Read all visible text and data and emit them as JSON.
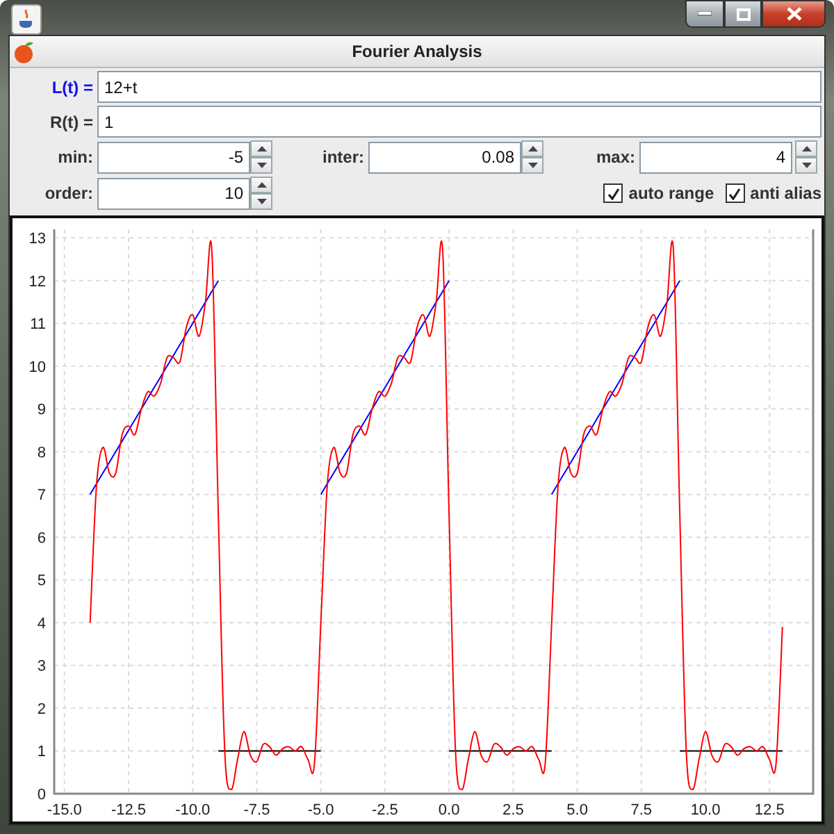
{
  "window": {
    "title": "Fourier Analysis"
  },
  "functions": [
    {
      "label": "L(t) =",
      "value": "12+t",
      "active": true
    },
    {
      "label": "R(t) =",
      "value": "1",
      "active": false
    }
  ],
  "spinners": [
    {
      "label": "min:",
      "value": "-5"
    },
    {
      "label": "inter:",
      "value": "0.08"
    },
    {
      "label": "max:",
      "value": "4"
    },
    {
      "label": "order:",
      "value": "10"
    }
  ],
  "checkboxes": [
    {
      "label": "auto range",
      "checked": true
    },
    {
      "label": "anti alias",
      "checked": true
    }
  ],
  "plot": {
    "chart_data": {
      "type": "line",
      "grid": true,
      "xlim": [
        -15.4,
        14.2
      ],
      "ylim": [
        0,
        13.2
      ],
      "xticks": [
        {
          "value": -15,
          "label": "-15.0"
        },
        {
          "value": -12.5,
          "label": "-12.5"
        },
        {
          "value": -10,
          "label": "-10.0"
        },
        {
          "value": -7.5,
          "label": "-7.5"
        },
        {
          "value": -5,
          "label": "-5.0"
        },
        {
          "value": -2.5,
          "label": "-2.5"
        },
        {
          "value": 0,
          "label": "0.0"
        },
        {
          "value": 2.5,
          "label": "2.5"
        },
        {
          "value": 5,
          "label": "5.0"
        },
        {
          "value": 7.5,
          "label": "7.5"
        },
        {
          "value": 10,
          "label": "10.0"
        },
        {
          "value": 12.5,
          "label": "12.5"
        }
      ],
      "yticks": [
        0,
        1,
        2,
        3,
        4,
        5,
        6,
        7,
        8,
        9,
        10,
        11,
        12,
        13
      ],
      "x": [
        -14,
        -13.75,
        -13.5,
        -13.25,
        -13,
        -12.75,
        -12.5,
        -12.25,
        -12,
        -11.75,
        -11.5,
        -11.25,
        -11,
        -10.75,
        -10.5,
        -10.25,
        -10,
        -9.75,
        -9.5,
        -9.25,
        -9,
        -8.75,
        -8.5,
        -8.25,
        -8,
        -7.75,
        -7.5,
        -7.25,
        -7,
        -6.75,
        -6.5,
        -6.25,
        -6,
        -5.75,
        -5.5,
        -5.25,
        -5,
        -4.75,
        -4.5,
        -4.25,
        -4,
        -3.75,
        -3.5,
        -3.25,
        -3,
        -2.75,
        -2.5,
        -2.25,
        -2,
        -1.75,
        -1.5,
        -1.25,
        -1,
        -0.75,
        -0.5,
        -0.25,
        0,
        0.25,
        0.5,
        0.75,
        1,
        1.25,
        1.5,
        1.75,
        2,
        2.25,
        2.5,
        2.75,
        3,
        3.25,
        3.5,
        3.75,
        4,
        4.25,
        4.5,
        4.75,
        5,
        5.25,
        5.5,
        5.75,
        6,
        6.25,
        6.5,
        6.75,
        7,
        7.25,
        7.5,
        7.75,
        8,
        8.25,
        8.5,
        8.75,
        9,
        9.25,
        9.5,
        9.75,
        10,
        10.25,
        10.5,
        10.75,
        11,
        11.25,
        11.5,
        11.75,
        12,
        12.25,
        12.5,
        12.75,
        13
      ],
      "series": [
        {
          "color": "#000000",
          "values": [
            null,
            null,
            null,
            null,
            null,
            null,
            null,
            null,
            null,
            null,
            null,
            null,
            null,
            null,
            null,
            null,
            null,
            null,
            null,
            null,
            1,
            1,
            1,
            1,
            1,
            1,
            1,
            1,
            1,
            1,
            1,
            1,
            1,
            1,
            1,
            1,
            1,
            null,
            null,
            null,
            null,
            null,
            null,
            null,
            null,
            null,
            null,
            null,
            null,
            null,
            null,
            null,
            null,
            null,
            null,
            null,
            1,
            1,
            1,
            1,
            1,
            1,
            1,
            1,
            1,
            1,
            1,
            1,
            1,
            1,
            1,
            1,
            1,
            null,
            null,
            null,
            null,
            null,
            null,
            null,
            null,
            null,
            null,
            null,
            null,
            null,
            null,
            null,
            null,
            null,
            null,
            null,
            1,
            1,
            1,
            1,
            1,
            1,
            1,
            1,
            1,
            1,
            1,
            1,
            1,
            1,
            1,
            1,
            1
          ]
        },
        {
          "color": "#0000ff",
          "values": [
            7,
            7.25,
            7.5,
            7.75,
            8,
            8.25,
            8.5,
            8.75,
            9,
            9.25,
            9.5,
            9.75,
            10,
            10.25,
            10.5,
            10.75,
            11,
            11.25,
            11.5,
            11.75,
            12,
            null,
            null,
            null,
            null,
            null,
            null,
            null,
            null,
            null,
            null,
            null,
            null,
            null,
            null,
            null,
            7,
            7.25,
            7.5,
            7.75,
            8,
            8.25,
            8.5,
            8.75,
            9,
            9.25,
            9.5,
            9.75,
            10,
            10.25,
            10.5,
            10.75,
            11,
            11.25,
            11.5,
            11.75,
            12,
            null,
            null,
            null,
            null,
            null,
            null,
            null,
            null,
            null,
            null,
            null,
            null,
            null,
            null,
            null,
            7,
            7.25,
            7.5,
            7.75,
            8,
            8.25,
            8.5,
            8.75,
            9,
            9.25,
            9.5,
            9.75,
            10,
            10.25,
            10.5,
            10.75,
            11,
            11.25,
            11.5,
            11.75,
            12,
            null,
            null,
            null,
            null,
            null,
            null,
            null,
            null,
            null,
            null,
            null,
            null,
            null,
            null,
            null,
            null
          ]
        },
        {
          "color": "#ff0000",
          "values": [
            4.0,
            7.2,
            8.1,
            7.5,
            7.5,
            8.4,
            8.6,
            8.4,
            9.0,
            9.4,
            9.3,
            9.6,
            10.2,
            10.2,
            10.1,
            10.9,
            11.2,
            10.7,
            11.5,
            12.7,
            6.5,
            1.0,
            0.1,
            0.8,
            1.45,
            0.9,
            0.75,
            1.15,
            1.1,
            0.9,
            1.05,
            1.1,
            1.0,
            1.1,
            0.8,
            0.7,
            4.0,
            7.2,
            8.1,
            7.5,
            7.5,
            8.4,
            8.6,
            8.4,
            9.0,
            9.4,
            9.3,
            9.6,
            10.2,
            10.2,
            10.1,
            10.9,
            11.2,
            10.7,
            11.5,
            12.7,
            6.5,
            1.0,
            0.1,
            0.8,
            1.45,
            0.9,
            0.75,
            1.15,
            1.1,
            0.9,
            1.05,
            1.1,
            1.0,
            1.1,
            0.8,
            0.7,
            4.0,
            7.2,
            8.1,
            7.5,
            7.5,
            8.4,
            8.6,
            8.4,
            9.0,
            9.4,
            9.3,
            9.6,
            10.2,
            10.2,
            10.1,
            10.9,
            11.2,
            10.7,
            11.5,
            12.7,
            6.5,
            1.0,
            0.1,
            0.8,
            1.45,
            0.9,
            0.75,
            1.15,
            1.1,
            0.9,
            1.05,
            1.1,
            1.0,
            1.1,
            0.8,
            0.7,
            3.9
          ]
        }
      ]
    }
  }
}
